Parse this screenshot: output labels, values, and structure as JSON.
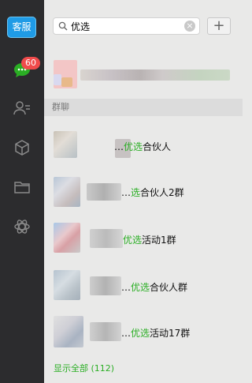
{
  "app": {
    "logo_text": "客服"
  },
  "nav": {
    "chat_badge": "60",
    "items": [
      "chat-icon",
      "contacts-icon",
      "cube-icon",
      "folder-icon",
      "settings-icon"
    ]
  },
  "search": {
    "value": "优选",
    "clear_symbol": "×",
    "add_symbol": "+"
  },
  "groups": {
    "section_title": "群聊",
    "items": [
      {
        "prefix": "…",
        "highlight": "优选",
        "suffix": "合伙人"
      },
      {
        "prefix": "…",
        "highlight": "选",
        "suffix": "合伙人2群"
      },
      {
        "prefix": "",
        "highlight": "优选",
        "suffix": "活动1群"
      },
      {
        "prefix": "…",
        "highlight": "优选",
        "suffix": "合伙人群"
      },
      {
        "prefix": "…",
        "highlight": "优选",
        "suffix": "活动17群"
      }
    ],
    "show_all": "显示全部 (112)"
  },
  "colors": {
    "accent": "#2aae24",
    "badge": "#f04b4b",
    "logo": "#1f9be6",
    "nav_bg": "#2c2c2e"
  }
}
